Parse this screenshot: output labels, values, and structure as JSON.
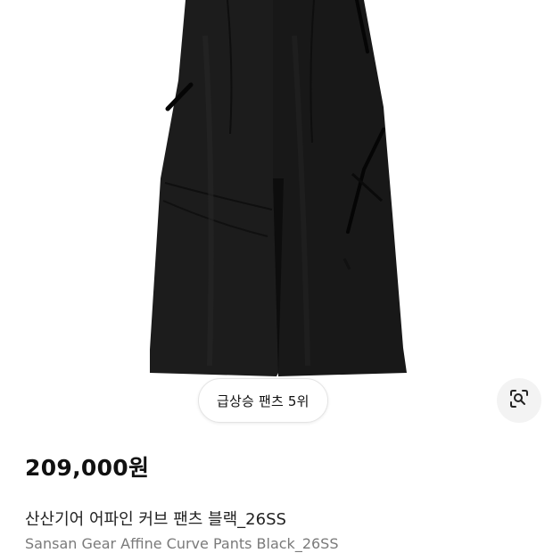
{
  "product": {
    "image_icon": "black-pants-photo",
    "rank_badge": "급상승 팬츠 5위",
    "lens_icon": "visual-search-icon",
    "price": "209,000원",
    "title_ko": "산산기어 어파인 커브 팬츠 블랙_26SS",
    "title_en": "Sansan Gear Affine Curve Pants Black_26SS"
  },
  "colors": {
    "pants": "#1a1a1a",
    "zip": "#0a0a0a",
    "chip_border": "#e4e4e4",
    "lens_bg": "#f3f3f3"
  }
}
